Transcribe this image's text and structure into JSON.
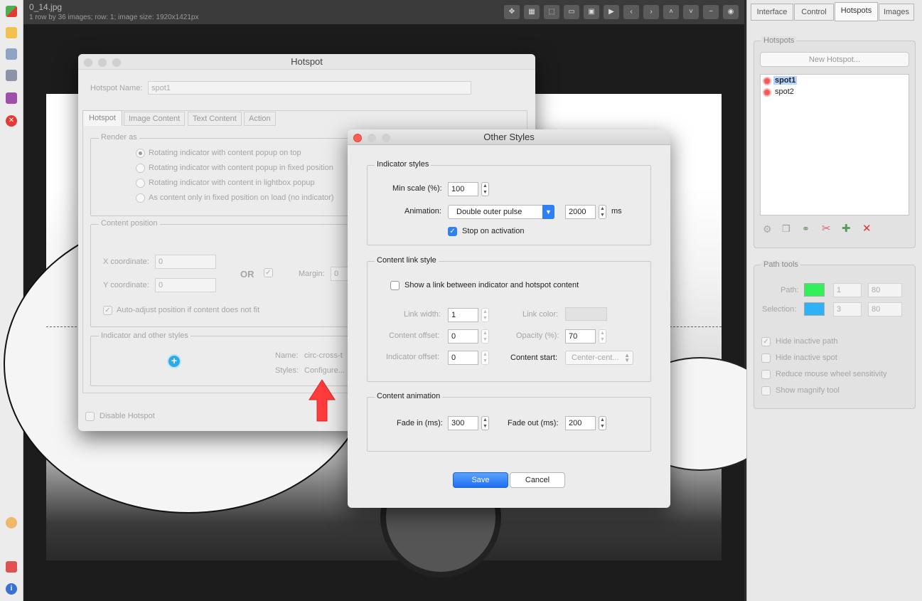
{
  "viewer": {
    "file_name": "0_14.jpg",
    "file_info": "1 row by 36 images; row: 1; image size: 1920x1421px"
  },
  "right_panel": {
    "tabs": [
      "Interface",
      "Control",
      "Hotspots",
      "Images"
    ],
    "active_tab": "Hotspots",
    "hotspots_group_title": "Hotspots",
    "new_hotspot_label": "New Hotspot...",
    "hotspot_list": [
      "spot1",
      "spot2"
    ],
    "selected_hotspot": "spot1",
    "path_tools": {
      "title": "Path tools",
      "path_label": "Path:",
      "path_color": "#33f05a",
      "path_width": "1",
      "path_opacity": "80",
      "selection_label": "Selection:",
      "selection_color": "#2fb1f5",
      "selection_width": "3",
      "selection_opacity": "80",
      "options": [
        {
          "label": "Hide inactive path",
          "checked": true
        },
        {
          "label": "Hide inactive spot",
          "checked": false
        },
        {
          "label": "Reduce mouse wheel sensitivity",
          "checked": false
        },
        {
          "label": "Show magnify tool",
          "checked": false
        }
      ]
    }
  },
  "hotspot_dialog": {
    "title": "Hotspot",
    "name_label": "Hotspot Name:",
    "name_value": "spot1",
    "tabs": [
      "Hotspot",
      "Image Content",
      "Text Content",
      "Action"
    ],
    "active_tab": "Hotspot",
    "render_as": {
      "title": "Render as",
      "options": [
        "Rotating indicator with content popup on top",
        "Rotating indicator with content popup in fixed position",
        "Rotating indicator with content in lightbox popup",
        "As content only in fixed position on load (no indicator)"
      ],
      "selected_index": 0
    },
    "content_position": {
      "title": "Content position",
      "x_label": "X coordinate:",
      "x_value": "0",
      "y_label": "Y coordinate:",
      "y_value": "0",
      "or_label": "OR",
      "margin_label": "Margin:",
      "margin_value": "0",
      "auto_adjust_label": "Auto-adjust position if content does not fit"
    },
    "indicator": {
      "title": "Indicator and other styles",
      "name_label": "Name:",
      "name_value": "circ-cross-t",
      "styles_label": "Styles:",
      "styles_value": "Configure..."
    },
    "disable_label": "Disable Hotspot"
  },
  "styles_dialog": {
    "title": "Other Styles",
    "indicator_styles": {
      "title": "Indicator styles",
      "min_scale_label": "Min scale (%):",
      "min_scale_value": "100",
      "animation_label": "Animation:",
      "animation_value": "Double outer pulse",
      "duration_value": "2000",
      "duration_unit": "ms",
      "stop_label": "Stop on activation"
    },
    "content_link": {
      "title": "Content link style",
      "show_link_label": "Show a link between indicator and hotspot content",
      "link_width_label": "Link width:",
      "link_width_value": "1",
      "link_color_label": "Link color:",
      "content_offset_label": "Content offset:",
      "content_offset_value": "0",
      "opacity_label": "Opacity (%):",
      "opacity_value": "70",
      "indicator_offset_label": "Indicator offset:",
      "indicator_offset_value": "0",
      "content_start_label": "Content start:",
      "content_start_value": "Center-cent..."
    },
    "content_animation": {
      "title": "Content animation",
      "fade_in_label": "Fade in (ms):",
      "fade_in_value": "300",
      "fade_out_label": "Fade out (ms):",
      "fade_out_value": "200"
    },
    "save_label": "Save",
    "cancel_label": "Cancel"
  }
}
